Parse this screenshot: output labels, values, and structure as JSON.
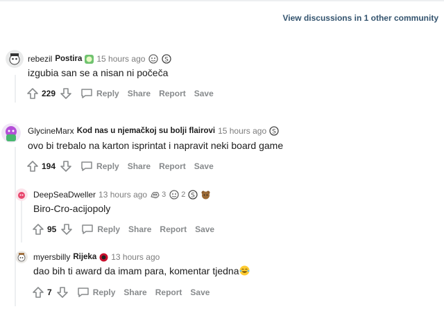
{
  "header": {
    "view_other": "View discussions in 1 other community"
  },
  "comments": [
    {
      "username": "rebezil",
      "flair": "Postira",
      "time": "15 hours ago",
      "text": "izgubia san se a nisan ni počeča",
      "votes": "229",
      "awards": [],
      "actions": {
        "reply": "Reply",
        "share": "Share",
        "report": "Report",
        "save": "Save"
      }
    },
    {
      "username": "GlycineMarx",
      "flair": "Kod nas u njemačkoj su bolji flairovi",
      "time": "15 hours ago",
      "text": "ovo bi trebalo na karton isprintat i napravit neki board game",
      "votes": "194",
      "awards": [],
      "actions": {
        "reply": "Reply",
        "share": "Share",
        "report": "Report",
        "save": "Save"
      }
    },
    {
      "username": "DeepSeaDweller",
      "flair": "",
      "time": "13 hours ago",
      "text": "Biro-Cro-acijopoly",
      "votes": "95",
      "awards": [
        {
          "count": "3"
        },
        {
          "count": "2"
        }
      ],
      "actions": {
        "reply": "Reply",
        "share": "Share",
        "report": "Report",
        "save": "Save"
      }
    },
    {
      "username": "myersbilly",
      "flair": "Rijeka",
      "time": "13 hours ago",
      "text": "dao bih ti award da imam para, komentar tjedna",
      "votes": "7",
      "awards": [],
      "actions": {
        "reply": "Reply",
        "share": "Share",
        "report": "Report",
        "save": "Save"
      }
    }
  ],
  "colors": {
    "meta_gray": "#7c7c7c",
    "action_gray": "#878a8c",
    "link_blue": "#33536e",
    "thread_line": "#edeff1"
  },
  "icons": [
    "upvote-icon",
    "downvote-icon",
    "comment-bubble-icon",
    "award-icon",
    "flair-emoji-icon",
    "avatar-icon"
  ]
}
